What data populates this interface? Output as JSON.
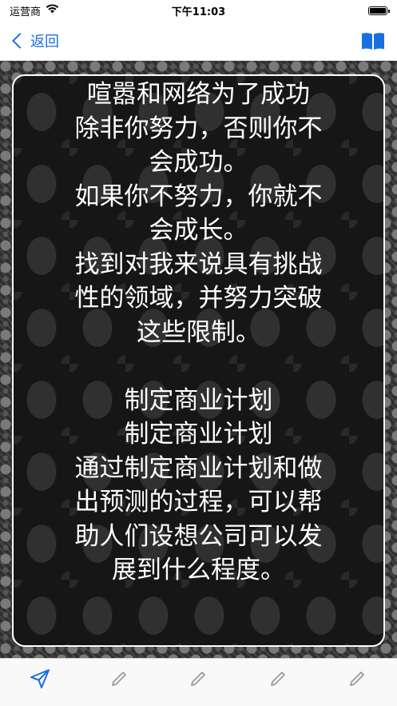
{
  "status_bar": {
    "carrier": "运营商",
    "time": "下午11:03",
    "icons": [
      "wifi-icon",
      "battery-icon"
    ]
  },
  "nav": {
    "back_label": "返回",
    "right_icon": "book-open-icon",
    "accent_color": "#1a6fe0"
  },
  "content": {
    "lines": [
      "喧嚣和网络为了成功",
      "除非你努力，否则你不",
      "会成功。",
      "如果你不努力，你就不",
      "会成长。",
      "找到对我来说具有挑战",
      "性的领域，并努力突破",
      "这些限制。",
      "",
      "制定商业计划",
      "制定商业计划",
      "通过制定商业计划和做",
      "出预测的过程，可以帮",
      "助人们设想公司可以发",
      "展到什么程度。"
    ]
  },
  "toolbar": {
    "items": [
      "send-icon",
      "pencil-icon",
      "pencil-icon",
      "pencil-icon",
      "pencil-icon"
    ],
    "active_color": "#1a6fe0",
    "inactive_color": "#9a9a9a"
  }
}
